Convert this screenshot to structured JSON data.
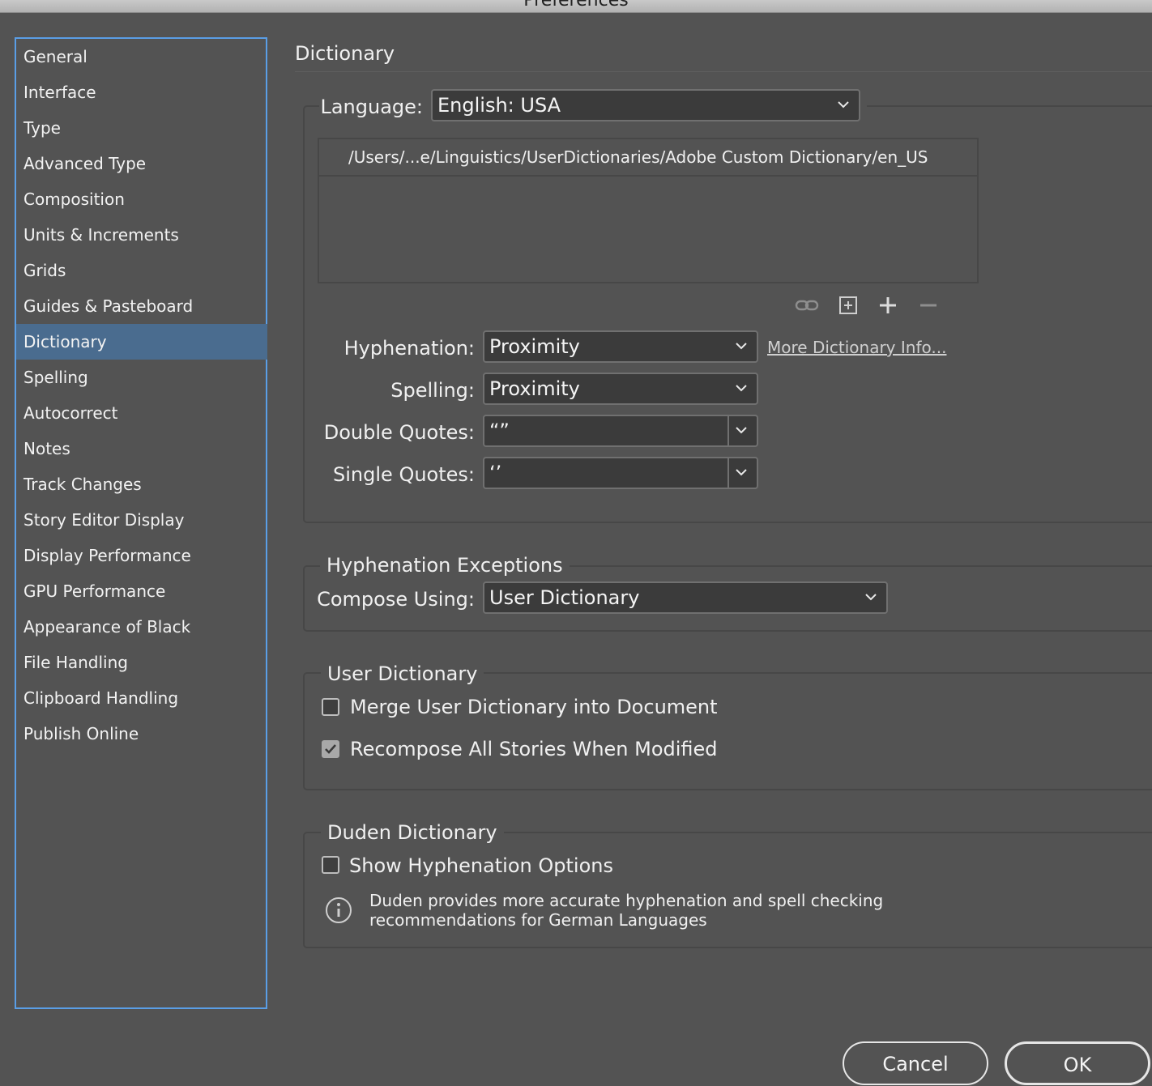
{
  "window": {
    "title": "Preferences"
  },
  "sidebar": {
    "items": [
      {
        "label": "General"
      },
      {
        "label": "Interface"
      },
      {
        "label": "Type"
      },
      {
        "label": "Advanced Type"
      },
      {
        "label": "Composition"
      },
      {
        "label": "Units & Increments"
      },
      {
        "label": "Grids"
      },
      {
        "label": "Guides & Pasteboard"
      },
      {
        "label": "Dictionary",
        "selected": true
      },
      {
        "label": "Spelling"
      },
      {
        "label": "Autocorrect"
      },
      {
        "label": "Notes"
      },
      {
        "label": "Track Changes"
      },
      {
        "label": "Story Editor Display"
      },
      {
        "label": "Display Performance"
      },
      {
        "label": "GPU Performance"
      },
      {
        "label": "Appearance of Black"
      },
      {
        "label": "File Handling"
      },
      {
        "label": "Clipboard Handling"
      },
      {
        "label": "Publish Online"
      }
    ]
  },
  "main": {
    "heading": "Dictionary",
    "language": {
      "label": "Language:",
      "value": "English: USA",
      "dictionaries": [
        "/Users/...e/Linguistics/UserDictionaries/Adobe Custom Dictionary/en_US"
      ],
      "icons": [
        "link-icon",
        "add-existing-icon",
        "plus-icon",
        "minus-icon"
      ]
    },
    "hyphenation": {
      "label": "Hyphenation:",
      "value": "Proximity"
    },
    "spelling": {
      "label": "Spelling:",
      "value": "Proximity"
    },
    "more_info_link": "More Dictionary Info...",
    "double_quotes": {
      "label": "Double Quotes:",
      "value": "“”"
    },
    "single_quotes": {
      "label": "Single Quotes:",
      "value": "‘’"
    },
    "hyphenation_exceptions": {
      "title": "Hyphenation Exceptions",
      "compose_label": "Compose Using:",
      "compose_value": "User Dictionary"
    },
    "user_dictionary": {
      "title": "User Dictionary",
      "merge_label": "Merge User Dictionary into Document",
      "merge_checked": false,
      "recompose_label": "Recompose All Stories When Modified",
      "recompose_checked": true
    },
    "duden": {
      "title": "Duden Dictionary",
      "show_label": "Show Hyphenation Options",
      "show_checked": false,
      "info_line1": "Duden provides more accurate hyphenation and spell checking",
      "info_line2": "recommendations for German Languages"
    }
  },
  "buttons": {
    "cancel": "Cancel",
    "ok": "OK"
  },
  "colors": {
    "background": "#535353",
    "selection": "#4a6c8f",
    "focus_border": "#5a9ee6"
  }
}
